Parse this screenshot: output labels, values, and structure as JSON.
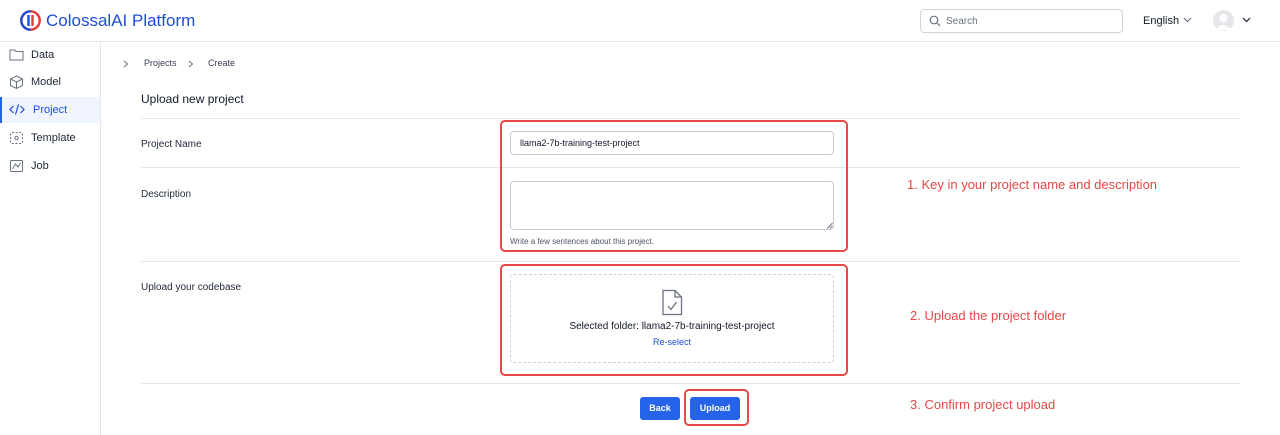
{
  "header": {
    "brand": "ColossalAI Platform",
    "search_placeholder": "Search",
    "language": "English"
  },
  "sidebar": {
    "items": [
      {
        "label": "Data",
        "icon": "folder-icon"
      },
      {
        "label": "Model",
        "icon": "cube-icon"
      },
      {
        "label": "Project",
        "icon": "code-icon",
        "active": true
      },
      {
        "label": "Template",
        "icon": "template-icon"
      },
      {
        "label": "Job",
        "icon": "job-icon"
      }
    ]
  },
  "breadcrumb": [
    "Projects",
    "Create"
  ],
  "form": {
    "title": "Upload new project",
    "project_name_label": "Project Name",
    "project_name_value": "llama2-7b-training-test-project",
    "description_label": "Description",
    "description_value": "",
    "description_hint": "Write a few sentences about this project.",
    "codebase_label": "Upload your codebase",
    "selected_folder": "Selected folder: llama2-7b-training-test-project",
    "reselect": "Re-select",
    "back": "Back",
    "upload": "Upload"
  },
  "annotations": {
    "step1": "1. Key in your project name and description",
    "step2": "2. Upload the project folder",
    "step3": "3. Confirm project upload"
  },
  "colors": {
    "accent": "#2563eb",
    "annotation": "#e64747"
  }
}
